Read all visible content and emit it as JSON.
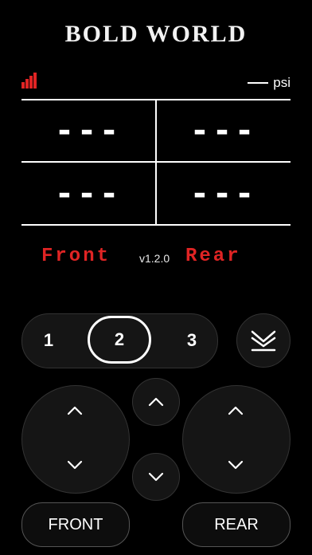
{
  "header": {
    "brand": "BOLD WORLD"
  },
  "status": {
    "signal_icon": "signal-bars-icon",
    "signal_color": "#e02424",
    "unit": "psi"
  },
  "pressures": {
    "front_left": "---",
    "front_right": "---",
    "rear_left": "---",
    "rear_right": "---"
  },
  "labels": {
    "front": "Front",
    "version": "v1.2.0",
    "rear": "Rear"
  },
  "presets": {
    "items": [
      "1",
      "2",
      "3"
    ],
    "selected": "2"
  },
  "controls": {
    "front_label": "FRONT",
    "rear_label": "REAR",
    "lower_icon": "lower-all-icon"
  },
  "colors": {
    "accent": "#e02424",
    "background": "#000000"
  }
}
